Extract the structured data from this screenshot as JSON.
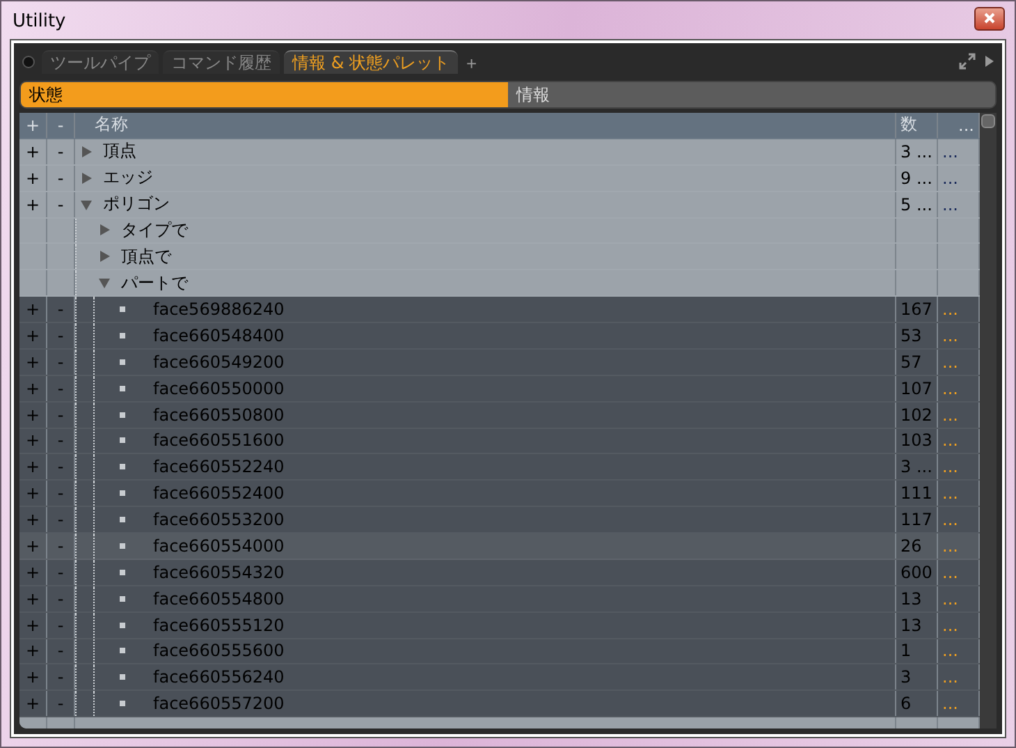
{
  "window": {
    "title": "Utility"
  },
  "tabs": [
    {
      "label": "ツールパイプ",
      "selected": false
    },
    {
      "label": "コマンド履歴",
      "selected": false
    },
    {
      "label": "情報 & 状態パレット",
      "selected": true
    }
  ],
  "add_tab": "+",
  "modes": [
    {
      "label": "状態",
      "selected": true
    },
    {
      "label": "情報",
      "selected": false
    }
  ],
  "table": {
    "columns": {
      "add": "+",
      "remove": "-",
      "name": "名称",
      "count": "数",
      "extra": "..."
    },
    "rows": [
      {
        "kind": "category",
        "add": "+",
        "remove": "-",
        "name": "頂点",
        "expanded": false,
        "count": "3 ...",
        "extra": "..."
      },
      {
        "kind": "category",
        "add": "+",
        "remove": "-",
        "name": "エッジ",
        "expanded": false,
        "count": "9 ...",
        "extra": "..."
      },
      {
        "kind": "category",
        "add": "+",
        "remove": "-",
        "name": "ポリゴン",
        "expanded": true,
        "count": "5 ...",
        "extra": "...",
        "children": [
          {
            "kind": "filter",
            "name": "タイプで",
            "expanded": false
          },
          {
            "kind": "filter",
            "name": "頂点で",
            "expanded": false
          },
          {
            "kind": "filter",
            "name": "パートで",
            "expanded": true,
            "children": [
              {
                "kind": "element",
                "add": "+",
                "remove": "-",
                "name": "face569886240",
                "count": "167",
                "extra": "...",
                "selected": false
              },
              {
                "kind": "element",
                "add": "+",
                "remove": "-",
                "name": "face660548400",
                "count": "53",
                "extra": "...",
                "selected": false
              },
              {
                "kind": "element",
                "add": "+",
                "remove": "-",
                "name": "face660549200",
                "count": "57",
                "extra": "...",
                "selected": false
              },
              {
                "kind": "element",
                "add": "+",
                "remove": "-",
                "name": "face660550000",
                "count": "107",
                "extra": "...",
                "selected": false
              },
              {
                "kind": "element",
                "add": "+",
                "remove": "-",
                "name": "face660550800",
                "count": "102",
                "extra": "...",
                "selected": false
              },
              {
                "kind": "element",
                "add": "+",
                "remove": "-",
                "name": "face660551600",
                "count": "103",
                "extra": "...",
                "selected": false
              },
              {
                "kind": "element",
                "add": "+",
                "remove": "-",
                "name": "face660552240",
                "count": "3 ...",
                "extra": "...",
                "selected": false
              },
              {
                "kind": "element",
                "add": "+",
                "remove": "-",
                "name": "face660552400",
                "count": "111",
                "extra": "...",
                "selected": false
              },
              {
                "kind": "element",
                "add": "+",
                "remove": "-",
                "name": "face660553200",
                "count": "117",
                "extra": "...",
                "selected": false
              },
              {
                "kind": "element",
                "add": "+",
                "remove": "-",
                "name": "face660554000",
                "count": "26",
                "extra": "...",
                "selected": true
              },
              {
                "kind": "element",
                "add": "+",
                "remove": "-",
                "name": "face660554320",
                "count": "600",
                "extra": "...",
                "selected": false
              },
              {
                "kind": "element",
                "add": "+",
                "remove": "-",
                "name": "face660554800",
                "count": "13",
                "extra": "...",
                "selected": false
              },
              {
                "kind": "element",
                "add": "+",
                "remove": "-",
                "name": "face660555120",
                "count": "13",
                "extra": "...",
                "selected": false
              },
              {
                "kind": "element",
                "add": "+",
                "remove": "-",
                "name": "face660555600",
                "count": "1",
                "extra": "...",
                "selected": false
              },
              {
                "kind": "element",
                "add": "+",
                "remove": "-",
                "name": "face660556240",
                "count": "3",
                "extra": "...",
                "selected": false
              },
              {
                "kind": "element",
                "add": "+",
                "remove": "-",
                "name": "face660557200",
                "count": "6",
                "extra": "...",
                "selected": false
              }
            ]
          }
        ]
      }
    ]
  }
}
